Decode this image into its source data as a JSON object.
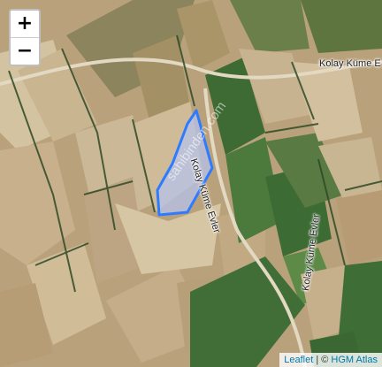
{
  "zoom": {
    "in_label": "+",
    "out_label": "−"
  },
  "roads": [
    {
      "label": "Kolay Küme E"
    },
    {
      "label": "Kolay Küme Evler"
    },
    {
      "label": "Kolay Küme Evler"
    }
  ],
  "watermark": "sahibinden.com",
  "attribution": {
    "leaflet": "Leaflet",
    "separator": " | © ",
    "atlas": "HGM Atlas"
  },
  "colors": {
    "parcel_stroke": "#2e7bff",
    "parcel_fill": "#b5c3ee",
    "link": "#0078a8"
  }
}
